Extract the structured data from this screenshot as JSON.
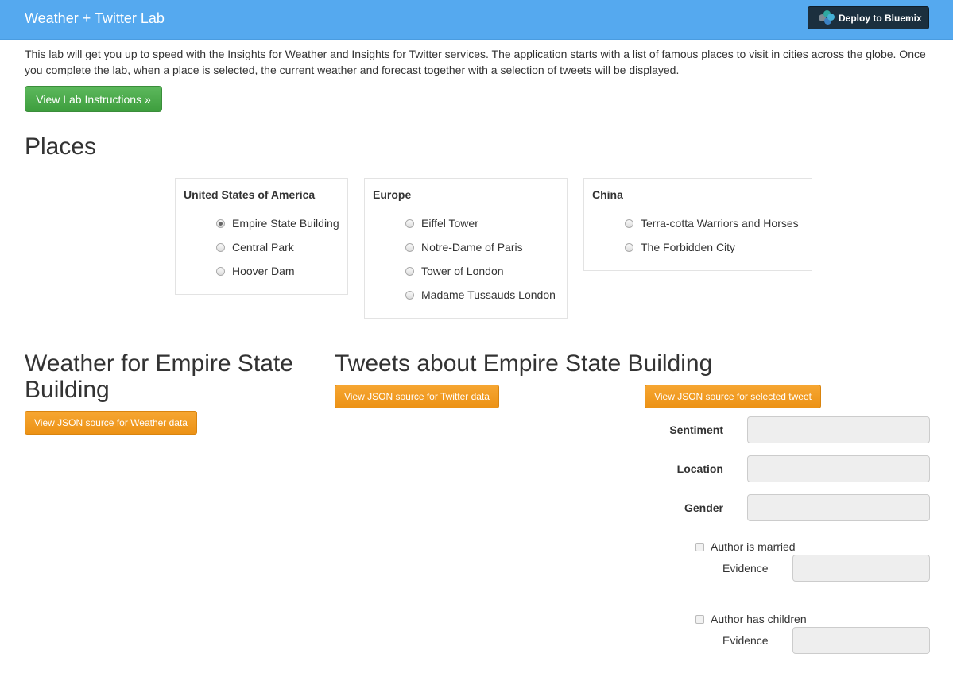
{
  "app": {
    "title": "Weather + Twitter Lab",
    "deploy_label": "Deploy to Bluemix"
  },
  "intro": {
    "text": "This lab will get you up to speed with the Insights for Weather and Insights for Twitter services. The application starts with a list of famous places to visit in cities across the globe. Once you complete the lab, when a place is selected, the current weather and forecast together with a selection of tweets will be displayed.",
    "button_label": "View Lab Instructions »"
  },
  "places": {
    "heading": "Places",
    "groups": [
      {
        "title": "United States of America",
        "items": [
          {
            "label": "Empire State Building",
            "selected": true
          },
          {
            "label": "Central Park",
            "selected": false
          },
          {
            "label": "Hoover Dam",
            "selected": false
          }
        ]
      },
      {
        "title": "Europe",
        "items": [
          {
            "label": "Eiffel Tower",
            "selected": false
          },
          {
            "label": "Notre-Dame of Paris",
            "selected": false
          },
          {
            "label": "Tower of London",
            "selected": false
          },
          {
            "label": "Madame Tussauds London",
            "selected": false
          }
        ]
      },
      {
        "title": "China",
        "items": [
          {
            "label": "Terra-cotta Warriors and Horses",
            "selected": false
          },
          {
            "label": "The Forbidden City",
            "selected": false
          }
        ]
      }
    ]
  },
  "weather": {
    "heading_line1": "Weather for Empire State",
    "heading_line2": "Building",
    "json_button": "View JSON source for Weather data"
  },
  "tweets": {
    "heading": "Tweets about Empire State Building",
    "json_button": "View JSON source for Twitter data",
    "selected_button": "View JSON source for selected tweet",
    "fields": {
      "sentiment_label": "Sentiment",
      "sentiment_value": "",
      "location_label": "Location",
      "location_value": "",
      "gender_label": "Gender",
      "gender_value": "",
      "married_label": "Author is married",
      "married_checked": false,
      "married_evidence_label": "Evidence",
      "married_evidence_value": "",
      "children_label": "Author has children",
      "children_checked": false,
      "children_evidence_label": "Evidence",
      "children_evidence_value": ""
    }
  },
  "colors": {
    "navbar": "#55a9ef",
    "green": "#4cae4c",
    "orange": "#f0a020",
    "deploy_bg": "#1b2f3e"
  }
}
